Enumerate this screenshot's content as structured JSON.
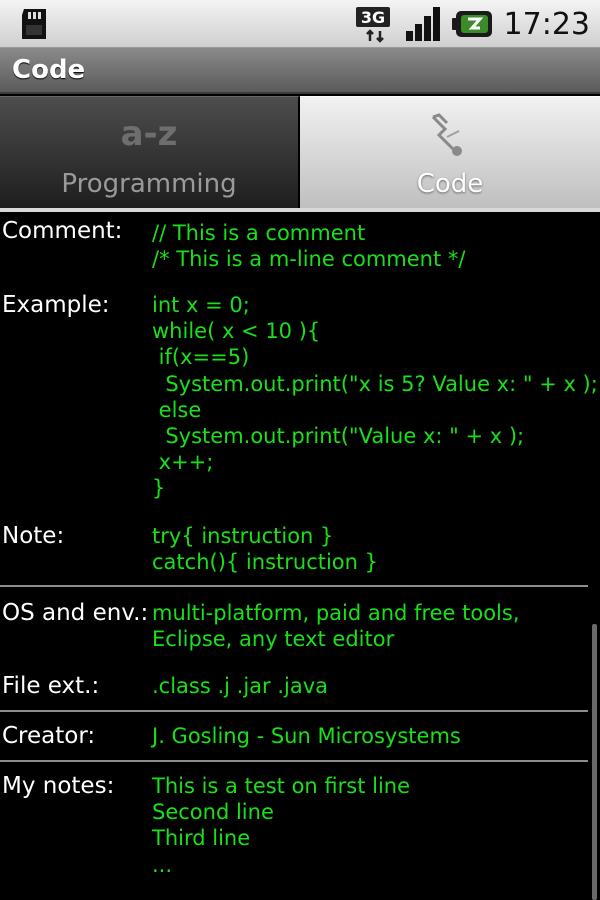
{
  "status_bar": {
    "network": "3G",
    "time": "17:23",
    "icons": [
      "sd-card-icon",
      "network-3g-icon",
      "signal-icon",
      "battery-icon"
    ]
  },
  "title_bar": {
    "title": "Code"
  },
  "tabs": [
    {
      "label": "Programming",
      "icon": "az-icon",
      "selected": false
    },
    {
      "label": "Code",
      "icon": "code-icon",
      "selected": true
    }
  ],
  "entries": [
    {
      "label": "Comment:",
      "value": "// This is a comment\n/* This is a m-line comment */"
    },
    {
      "label": "Example:",
      "value": "int x = 0;\nwhile( x < 10 ){\n if(x==5)\n  System.out.print(\"x is 5? Value x: \" + x );\n else\n  System.out.print(\"Value x: \" + x );\n x++;\n}"
    },
    {
      "label": "Note:",
      "value": "try{ instruction }\ncatch(){ instruction }"
    },
    {
      "label": "OS and env.:",
      "value": "multi-platform, paid and free tools,\nEclipse, any text editor"
    },
    {
      "label": "File ext.:",
      "value": ".class .j .jar .java"
    },
    {
      "label": "Creator:",
      "value": "J. Gosling - Sun Microsystems"
    },
    {
      "label": "My notes:",
      "value": "This is a test on first line\nSecond line\nThird line\n..."
    }
  ],
  "colors": {
    "code_text": "#19e019",
    "background": "#000000"
  }
}
